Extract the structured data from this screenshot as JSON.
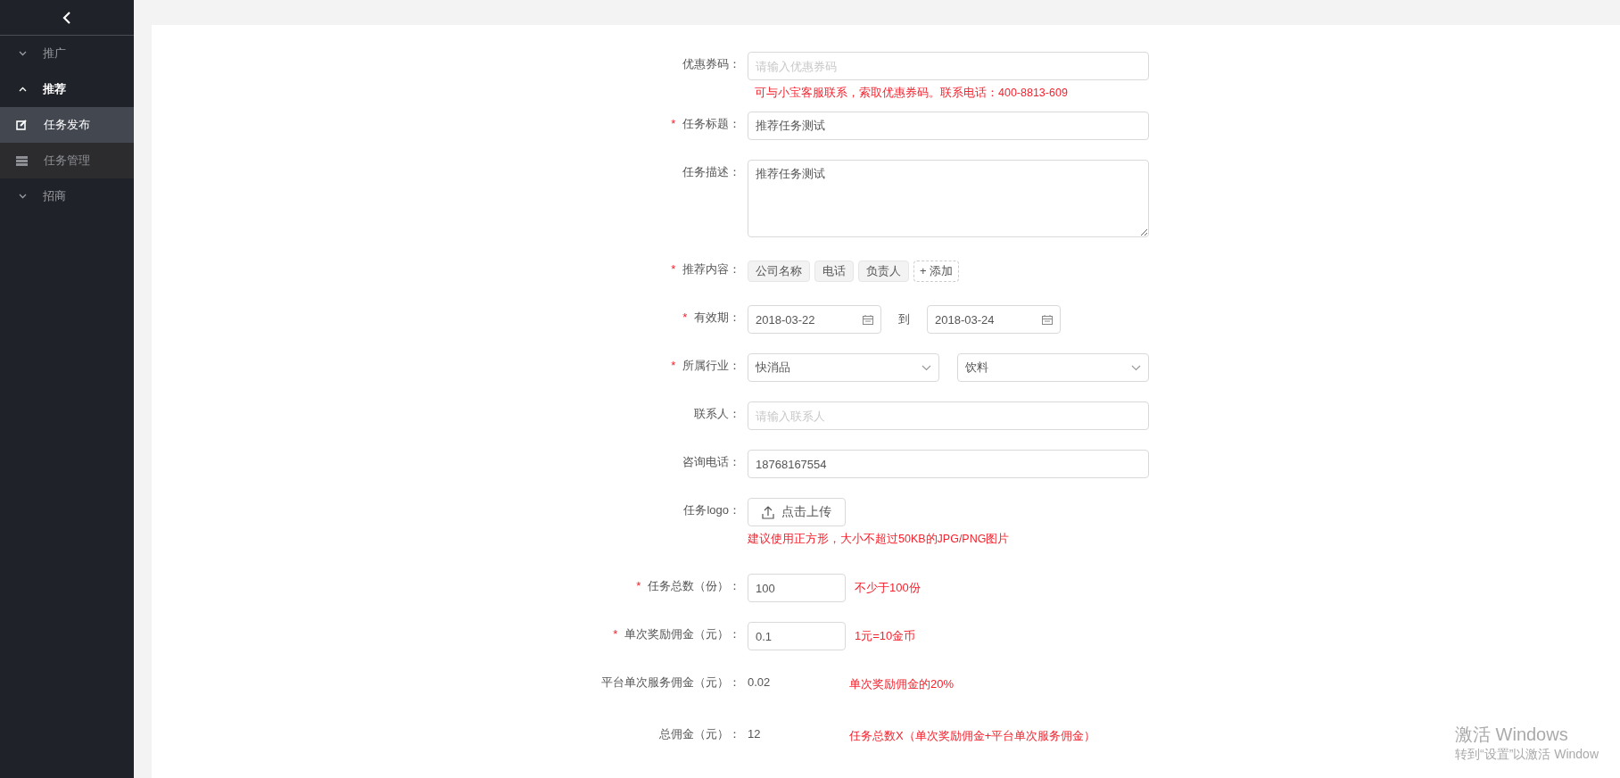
{
  "sidebar": {
    "items": [
      {
        "label": "推广",
        "expanded": false
      },
      {
        "label": "推荐",
        "expanded": true,
        "children": [
          {
            "label": "任务发布",
            "selected": true
          },
          {
            "label": "任务管理",
            "selected": false
          }
        ]
      },
      {
        "label": "招商",
        "expanded": false
      }
    ]
  },
  "form": {
    "fields": [
      {
        "kind": "input",
        "label": "优惠券码：",
        "placeholder": "请输入优惠券码",
        "hint": "可与小宝客服联系，索取优惠券码。联系电话：400-8813-609"
      },
      {
        "kind": "input",
        "label": "任务标题：",
        "mark": "*",
        "value": "推荐任务测试"
      },
      {
        "kind": "textarea",
        "label": "任务描述：",
        "value": "推荐任务测试"
      },
      {
        "kind": "tags",
        "label": "推荐内容：",
        "mark": "*",
        "tags": [
          "公司名称",
          "电话",
          "负责人"
        ],
        "add_label": "+ 添加"
      },
      {
        "kind": "daterange",
        "label": "有效期：",
        "mark": "*",
        "start": "2018-03-22",
        "separator": "到",
        "end": "2018-03-24"
      },
      {
        "kind": "selects",
        "label": "所属行业：",
        "mark": "*",
        "values": [
          "快消品",
          "饮料"
        ]
      },
      {
        "kind": "input",
        "label": "联系人：",
        "placeholder": "请输入联系人"
      },
      {
        "kind": "input",
        "label": "咨询电话：",
        "value": "18768167554"
      },
      {
        "kind": "upload",
        "label": "任务logo：",
        "button": "点击上传",
        "hint": "建议使用正方形，大小不超过50KB的JPG/PNG图片"
      },
      {
        "kind": "number",
        "label": "任务总数（份）：",
        "mark": "*",
        "value": "100",
        "note": "不少于100份"
      },
      {
        "kind": "number",
        "label": "单次奖励佣金（元）：",
        "mark": "*",
        "value": "0.1",
        "note": "1元=10金币"
      },
      {
        "kind": "static",
        "label": "平台单次服务佣金（元）：",
        "value": "0.02",
        "note": "单次奖励佣金的20%"
      },
      {
        "kind": "static",
        "label": "总佣金（元）：",
        "value": "12",
        "note": "任务总数X（单次奖励佣金+平台单次服务佣金）"
      }
    ]
  },
  "os_notice": {
    "title": "激活 Windows",
    "text": "转到“设置”以激活 Window"
  }
}
